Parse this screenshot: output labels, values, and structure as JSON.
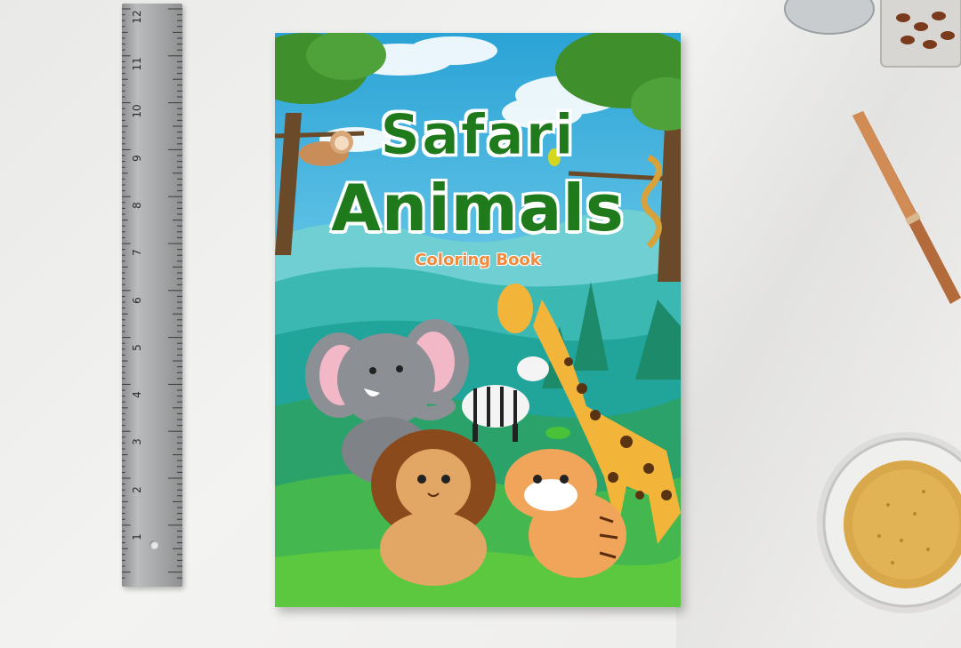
{
  "book": {
    "title_line1": "Safari",
    "title_line2": "Animals",
    "subtitle": "Coloring Book"
  },
  "ruler": {
    "numbers": [
      "12",
      "11",
      "10",
      "9",
      "8",
      "7",
      "6",
      "5",
      "4",
      "3",
      "2",
      "1"
    ]
  },
  "colors": {
    "title_green": "#1e7a1a",
    "subtitle_orange": "#f08a3c",
    "sky_blue": "#3fb6e0",
    "grass_green": "#4cb94a"
  }
}
